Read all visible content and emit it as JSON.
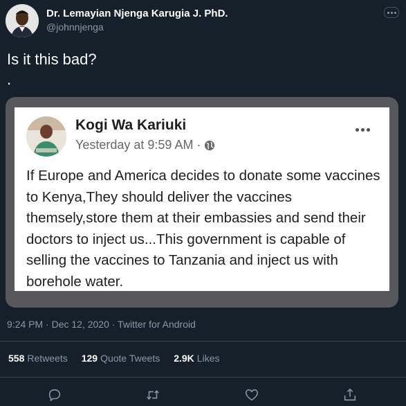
{
  "author": {
    "name": "Dr. Lemayian Njenga Karugia J. PhD.",
    "handle": "@johnnjenga"
  },
  "tweet": {
    "text": "Is it this bad?",
    "dot": "."
  },
  "embedded_post": {
    "name": "Kogi Wa Kariuki",
    "time": "Yesterday at 9:59 AM ·",
    "body": "If Europe and America decides to donate some vaccines to Kenya,They should deliver the vaccines themsely,store them at their embassies and send their doctors to inject us...This government is capable of selling the vaccines to Tanzania and inject us with borehole water."
  },
  "meta": {
    "line": "9:24 PM · Dec 12, 2020 · Twitter for Android"
  },
  "stats": {
    "retweets_count": "558",
    "retweets_label": "Retweets",
    "quotes_count": "129",
    "quotes_label": "Quote Tweets",
    "likes_count": "2.9K",
    "likes_label": "Likes"
  },
  "actions": {
    "icons": [
      "reply-icon",
      "retweet-icon",
      "like-icon",
      "share-icon"
    ]
  },
  "colors": {
    "background": "#15202b",
    "secondary_text": "#8899a6",
    "divider": "#38444d"
  }
}
